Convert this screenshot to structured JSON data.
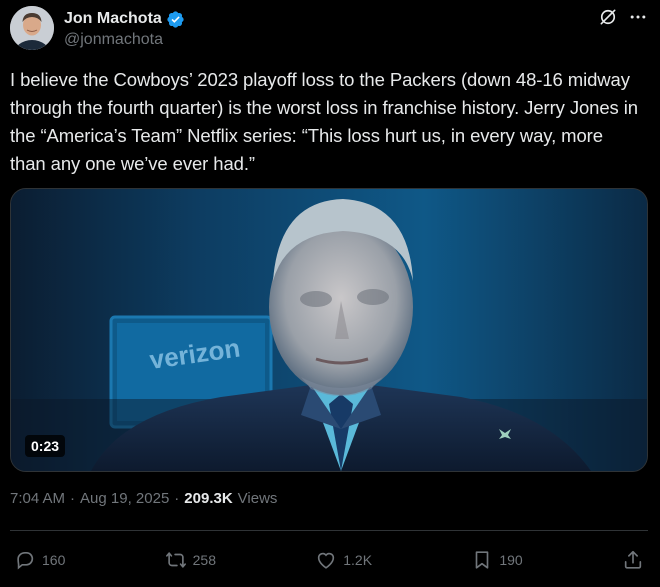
{
  "author": {
    "display_name": "Jon Machota",
    "handle": "@jonmachota"
  },
  "tweet": {
    "text": "I believe the Cowboys’ 2023 playoff loss to the Packers (down 48-16 midway through the fourth quarter) is the worst loss in franchise history. Jerry Jones in the “America’s Team” Netflix series: “This loss hurt us, in every way, more than any one we’ve ever had.”"
  },
  "media": {
    "duration": "0:23",
    "background_text": "verizon"
  },
  "meta": {
    "time": "7:04 AM",
    "separator": "·",
    "date": "Aug 19, 2025",
    "views_count": "209.3K",
    "views_label": "Views"
  },
  "actions": {
    "replies": "160",
    "reposts": "258",
    "likes": "1.2K",
    "bookmarks": "190"
  },
  "icons": {
    "verified": "verified-badge-icon",
    "grok": "grok-icon",
    "more": "more-icon",
    "reply": "reply-icon",
    "repost": "repost-icon",
    "like": "heart-icon",
    "bookmark": "bookmark-icon",
    "share": "share-icon"
  },
  "colors": {
    "background": "#000000",
    "text": "#e7e9ea",
    "muted": "#71767b",
    "verified": "#1d9bf0",
    "border": "#2f3336"
  }
}
